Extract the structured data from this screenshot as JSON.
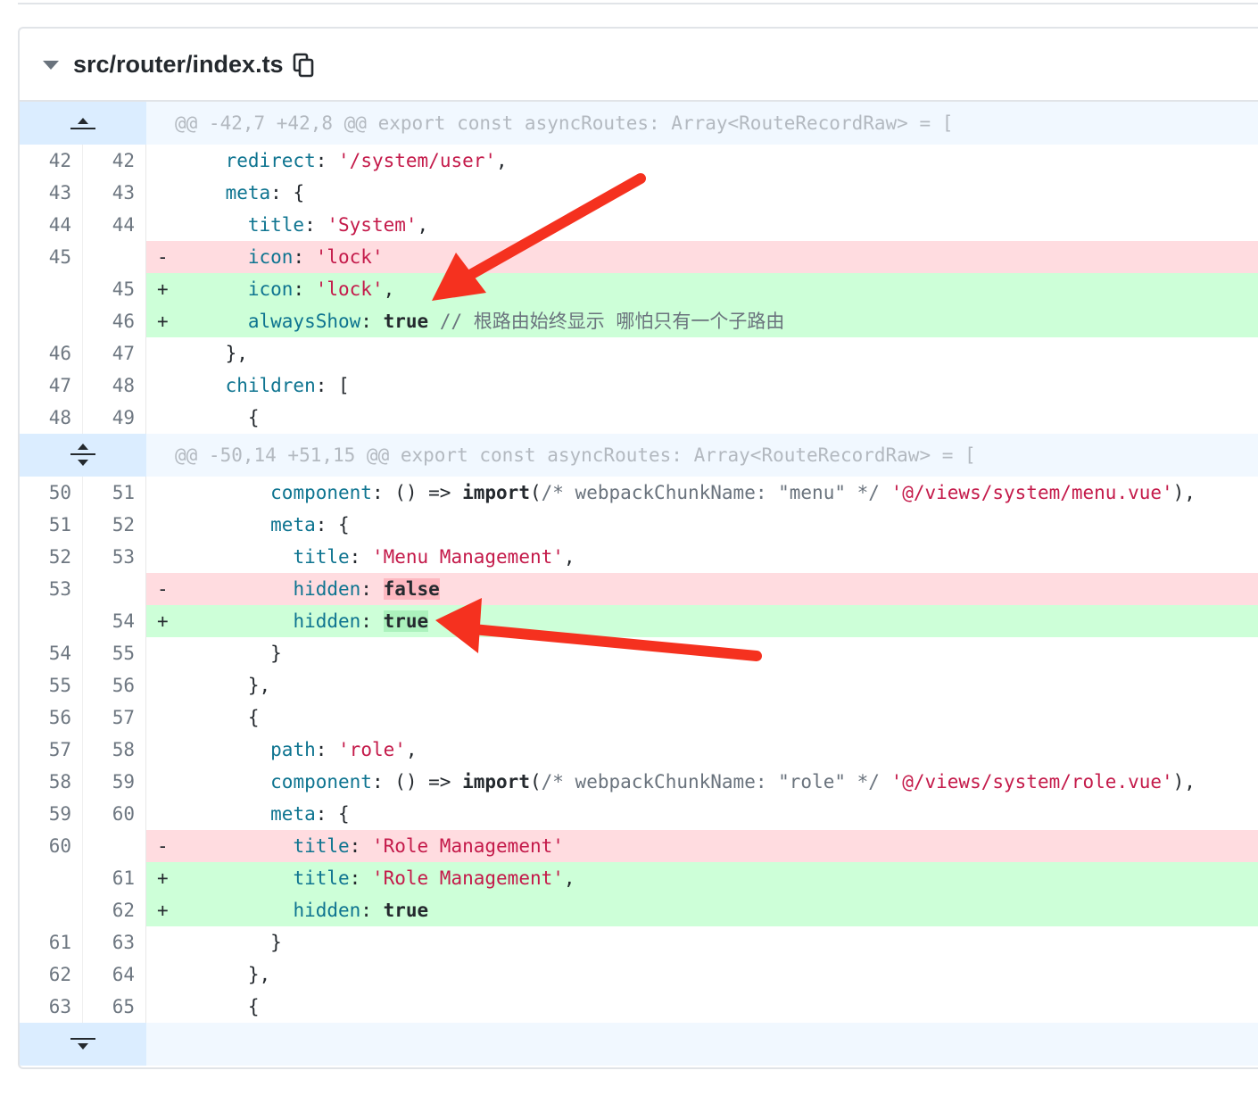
{
  "file": {
    "path": "src/router/index.ts"
  },
  "hunks": [
    "@@ -42,7 +42,8 @@ export const asyncRoutes: Array<RouteRecordRaw> = [",
    "@@ -50,14 +51,15 @@ export const asyncRoutes: Array<RouteRecordRaw> = ["
  ],
  "lines": [
    {
      "old": "42",
      "new": "42",
      "type": "ctx",
      "indent": "    ",
      "tokens": [
        {
          "t": "redirect",
          "c": "prop"
        },
        {
          "t": ": ",
          "c": "pl"
        },
        {
          "t": "'/system/user'",
          "c": "str"
        },
        {
          "t": ",",
          "c": "pl"
        }
      ]
    },
    {
      "old": "43",
      "new": "43",
      "type": "ctx",
      "indent": "    ",
      "tokens": [
        {
          "t": "meta",
          "c": "prop"
        },
        {
          "t": ": {",
          "c": "pl"
        }
      ]
    },
    {
      "old": "44",
      "new": "44",
      "type": "ctx",
      "indent": "      ",
      "tokens": [
        {
          "t": "title",
          "c": "prop"
        },
        {
          "t": ": ",
          "c": "pl"
        },
        {
          "t": "'System'",
          "c": "str"
        },
        {
          "t": ",",
          "c": "pl"
        }
      ]
    },
    {
      "old": "45",
      "new": "",
      "type": "del",
      "indent": "      ",
      "tokens": [
        {
          "t": "icon",
          "c": "prop"
        },
        {
          "t": ": ",
          "c": "pl"
        },
        {
          "t": "'lock'",
          "c": "str"
        }
      ]
    },
    {
      "old": "",
      "new": "45",
      "type": "add",
      "indent": "      ",
      "tokens": [
        {
          "t": "icon",
          "c": "prop"
        },
        {
          "t": ": ",
          "c": "pl"
        },
        {
          "t": "'lock'",
          "c": "str"
        },
        {
          "t": ",",
          "c": "pl"
        }
      ]
    },
    {
      "old": "",
      "new": "46",
      "type": "add",
      "indent": "      ",
      "tokens": [
        {
          "t": "alwaysShow",
          "c": "prop"
        },
        {
          "t": ": ",
          "c": "pl"
        },
        {
          "t": "true",
          "c": "kw"
        },
        {
          "t": " // 根路由始终显示 哪怕只有一个子路由",
          "c": "cmt"
        }
      ]
    },
    {
      "old": "46",
      "new": "47",
      "type": "ctx",
      "indent": "    ",
      "tokens": [
        {
          "t": "},",
          "c": "pl"
        }
      ]
    },
    {
      "old": "47",
      "new": "48",
      "type": "ctx",
      "indent": "    ",
      "tokens": [
        {
          "t": "children",
          "c": "prop"
        },
        {
          "t": ": [",
          "c": "pl"
        }
      ]
    },
    {
      "old": "48",
      "new": "49",
      "type": "ctx",
      "indent": "      ",
      "tokens": [
        {
          "t": "{",
          "c": "pl"
        }
      ]
    },
    {
      "hunk": 1
    },
    {
      "old": "50",
      "new": "51",
      "type": "ctx",
      "indent": "        ",
      "tokens": [
        {
          "t": "component",
          "c": "prop"
        },
        {
          "t": ": () => ",
          "c": "pl"
        },
        {
          "t": "import",
          "c": "kw"
        },
        {
          "t": "(",
          "c": "pl"
        },
        {
          "t": "/* webpackChunkName: \"menu\" */",
          "c": "cmt"
        },
        {
          "t": " ",
          "c": "pl"
        },
        {
          "t": "'@/views/system/menu.vue'",
          "c": "str"
        },
        {
          "t": "),",
          "c": "pl"
        }
      ]
    },
    {
      "old": "51",
      "new": "52",
      "type": "ctx",
      "indent": "        ",
      "tokens": [
        {
          "t": "meta",
          "c": "prop"
        },
        {
          "t": ": {",
          "c": "pl"
        }
      ]
    },
    {
      "old": "52",
      "new": "53",
      "type": "ctx",
      "indent": "          ",
      "tokens": [
        {
          "t": "title",
          "c": "prop"
        },
        {
          "t": ": ",
          "c": "pl"
        },
        {
          "t": "'Menu Management'",
          "c": "str"
        },
        {
          "t": ",",
          "c": "pl"
        }
      ]
    },
    {
      "old": "53",
      "new": "",
      "type": "del",
      "indent": "          ",
      "tokens": [
        {
          "t": "hidden",
          "c": "prop"
        },
        {
          "t": ": ",
          "c": "pl"
        },
        {
          "t": "false",
          "c": "kw hl-del"
        }
      ]
    },
    {
      "old": "",
      "new": "54",
      "type": "add",
      "indent": "          ",
      "tokens": [
        {
          "t": "hidden",
          "c": "prop"
        },
        {
          "t": ": ",
          "c": "pl"
        },
        {
          "t": "true",
          "c": "kw hl-add"
        }
      ]
    },
    {
      "old": "54",
      "new": "55",
      "type": "ctx",
      "indent": "        ",
      "tokens": [
        {
          "t": "}",
          "c": "pl"
        }
      ]
    },
    {
      "old": "55",
      "new": "56",
      "type": "ctx",
      "indent": "      ",
      "tokens": [
        {
          "t": "},",
          "c": "pl"
        }
      ]
    },
    {
      "old": "56",
      "new": "57",
      "type": "ctx",
      "indent": "      ",
      "tokens": [
        {
          "t": "{",
          "c": "pl"
        }
      ]
    },
    {
      "old": "57",
      "new": "58",
      "type": "ctx",
      "indent": "        ",
      "tokens": [
        {
          "t": "path",
          "c": "prop"
        },
        {
          "t": ": ",
          "c": "pl"
        },
        {
          "t": "'role'",
          "c": "str"
        },
        {
          "t": ",",
          "c": "pl"
        }
      ]
    },
    {
      "old": "58",
      "new": "59",
      "type": "ctx",
      "indent": "        ",
      "tokens": [
        {
          "t": "component",
          "c": "prop"
        },
        {
          "t": ": () => ",
          "c": "pl"
        },
        {
          "t": "import",
          "c": "kw"
        },
        {
          "t": "(",
          "c": "pl"
        },
        {
          "t": "/* webpackChunkName: \"role\" */",
          "c": "cmt"
        },
        {
          "t": " ",
          "c": "pl"
        },
        {
          "t": "'@/views/system/role.vue'",
          "c": "str"
        },
        {
          "t": "),",
          "c": "pl"
        }
      ]
    },
    {
      "old": "59",
      "new": "60",
      "type": "ctx",
      "indent": "        ",
      "tokens": [
        {
          "t": "meta",
          "c": "prop"
        },
        {
          "t": ": {",
          "c": "pl"
        }
      ]
    },
    {
      "old": "60",
      "new": "",
      "type": "del",
      "indent": "          ",
      "tokens": [
        {
          "t": "title",
          "c": "prop"
        },
        {
          "t": ": ",
          "c": "pl"
        },
        {
          "t": "'Role Management'",
          "c": "str"
        }
      ]
    },
    {
      "old": "",
      "new": "61",
      "type": "add",
      "indent": "          ",
      "tokens": [
        {
          "t": "title",
          "c": "prop"
        },
        {
          "t": ": ",
          "c": "pl"
        },
        {
          "t": "'Role Management'",
          "c": "str"
        },
        {
          "t": ",",
          "c": "pl"
        }
      ]
    },
    {
      "old": "",
      "new": "62",
      "type": "add",
      "indent": "          ",
      "tokens": [
        {
          "t": "hidden",
          "c": "prop"
        },
        {
          "t": ": ",
          "c": "pl"
        },
        {
          "t": "true",
          "c": "kw"
        }
      ]
    },
    {
      "old": "61",
      "new": "63",
      "type": "ctx",
      "indent": "        ",
      "tokens": [
        {
          "t": "}",
          "c": "pl"
        }
      ]
    },
    {
      "old": "62",
      "new": "64",
      "type": "ctx",
      "indent": "      ",
      "tokens": [
        {
          "t": "},",
          "c": "pl"
        }
      ]
    },
    {
      "old": "63",
      "new": "65",
      "type": "ctx",
      "indent": "      ",
      "tokens": [
        {
          "t": "{",
          "c": "pl"
        }
      ]
    }
  ],
  "colors": {
    "deleted_bg": "#ffdce0",
    "added_bg": "#cdffd8",
    "hunk_bg": "#f1f8ff",
    "arrow": "#f5311f"
  }
}
